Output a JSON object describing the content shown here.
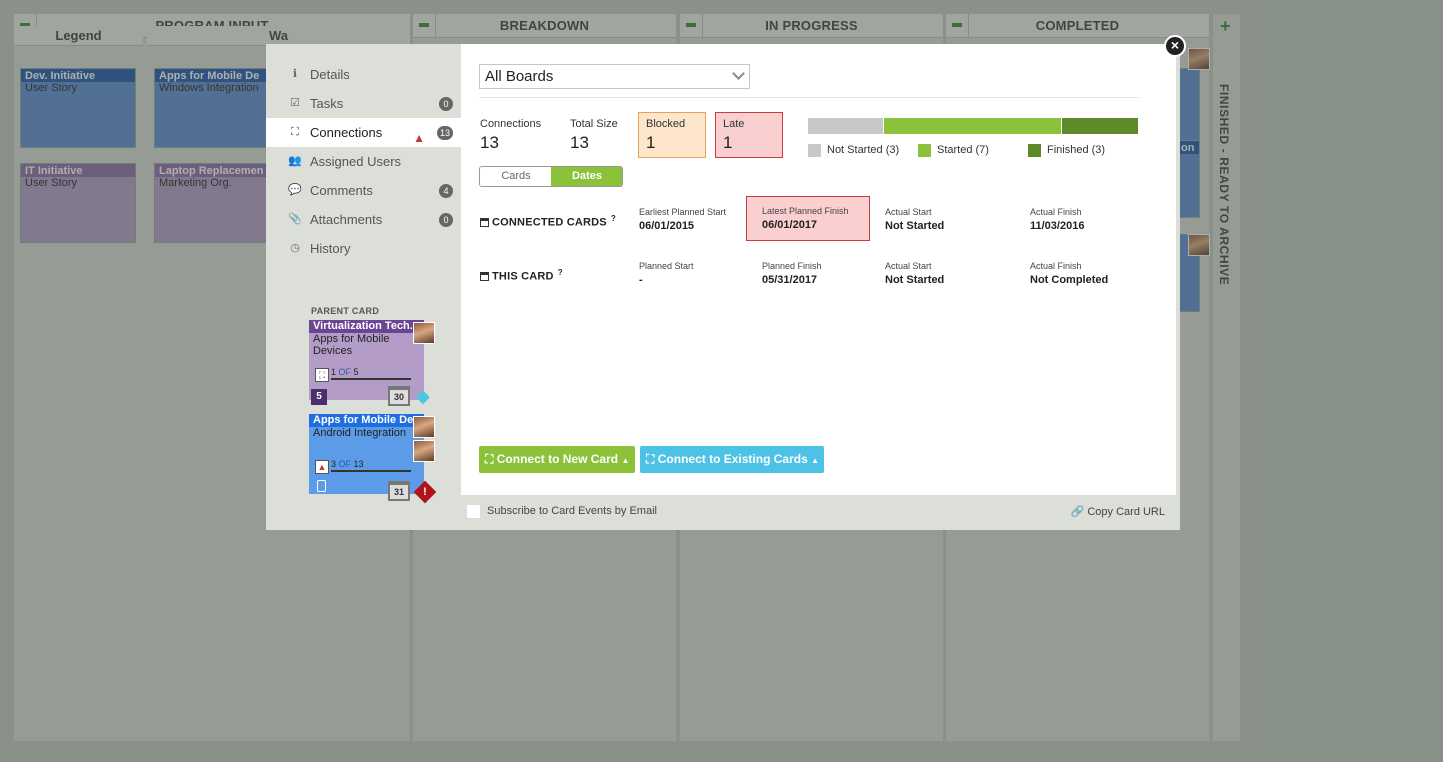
{
  "board": {
    "lanes": [
      {
        "title": "PROGRAM INPUT"
      },
      {
        "title": "BREAKDOWN"
      },
      {
        "title": "IN PROGRESS"
      },
      {
        "title": "COMPLETED"
      }
    ],
    "sublanes": [
      "Legend",
      "Wa"
    ],
    "archive_label": "FINISHED - READY TO ARCHIVE",
    "cards": [
      {
        "title": "Dev. Initiative",
        "subtitle": "User Story"
      },
      {
        "title": "IT Initiative",
        "subtitle": "User Story"
      },
      {
        "title": "Apps for Mobile De",
        "subtitle": "Windows Integration"
      },
      {
        "title": "Laptop Replacemen",
        "subtitle": "Marketing Org."
      }
    ],
    "completed_card_snippet": "on"
  },
  "modal": {
    "nav": [
      {
        "label": "Details",
        "icon": "info-icon"
      },
      {
        "label": "Tasks",
        "icon": "checkbox-icon",
        "count": "0"
      },
      {
        "label": "Connections",
        "icon": "hierarchy-icon",
        "count": "13",
        "warning": true
      },
      {
        "label": "Assigned Users",
        "icon": "users-icon"
      },
      {
        "label": "Comments",
        "icon": "comment-icon",
        "count": "4"
      },
      {
        "label": "Attachments",
        "icon": "paperclip-icon",
        "count": "0"
      },
      {
        "label": "History",
        "icon": "clock-icon"
      }
    ],
    "parent_card_label": "PARENT CARD",
    "parent_cards": [
      {
        "title": "Virtualization Tech.",
        "subtitle": "Apps for Mobile Devices",
        "progress_done": "1",
        "progress_of": "OF",
        "progress_total": "5",
        "size": "5",
        "day": "30"
      },
      {
        "title": "Apps for Mobile De",
        "subtitle": "Android Integration",
        "progress_done": "3",
        "progress_of": "OF",
        "progress_total": "13",
        "day": "31"
      }
    ],
    "board_select": {
      "value": "All Boards"
    },
    "stats": {
      "connections": {
        "label": "Connections",
        "value": "13"
      },
      "total_size": {
        "label": "Total Size",
        "value": "13"
      },
      "blocked": {
        "label": "Blocked",
        "value": "1"
      },
      "late": {
        "label": "Late",
        "value": "1"
      }
    },
    "status_bar": {
      "not_started": {
        "label": "Not Started (3)",
        "count": 3,
        "color": "#c8c8c8"
      },
      "started": {
        "label": "Started (7)",
        "count": 7,
        "color": "#8cc13a"
      },
      "finished": {
        "label": "Finished (3)",
        "count": 3,
        "color": "#5e8a2a"
      }
    },
    "view_toggle": {
      "cards": "Cards",
      "dates": "Dates",
      "active": "Dates"
    },
    "connected_cards": {
      "label": "CONNECTED CARDS",
      "help": "?",
      "earliest_planned_start": {
        "label": "Earliest Planned Start",
        "value": "06/01/2015"
      },
      "latest_planned_finish": {
        "label": "Latest Planned Finish",
        "value": "06/01/2017"
      },
      "actual_start": {
        "label": "Actual Start",
        "value": "Not Started"
      },
      "actual_finish": {
        "label": "Actual Finish",
        "value": "11/03/2016"
      }
    },
    "this_card": {
      "label": "THIS CARD",
      "help": "?",
      "planned_start": {
        "label": "Planned Start",
        "value": "-"
      },
      "planned_finish": {
        "label": "Planned Finish",
        "value": "05/31/2017"
      },
      "actual_start": {
        "label": "Actual Start",
        "value": "Not Started"
      },
      "actual_finish": {
        "label": "Actual Finish",
        "value": "Not Completed"
      }
    },
    "buttons": {
      "connect_new": "Connect to New Card",
      "connect_existing": "Connect to Existing Cards"
    },
    "footer": {
      "subscribe_label": "Subscribe to Card Events by Email",
      "copy_url": "Copy Card URL"
    },
    "close": "×"
  },
  "colors": {
    "accent_green": "#8cc13a",
    "accent_blue": "#4cc3e6",
    "blocked_bg": "#fde6c9",
    "late_bg": "#f9cfd0"
  }
}
